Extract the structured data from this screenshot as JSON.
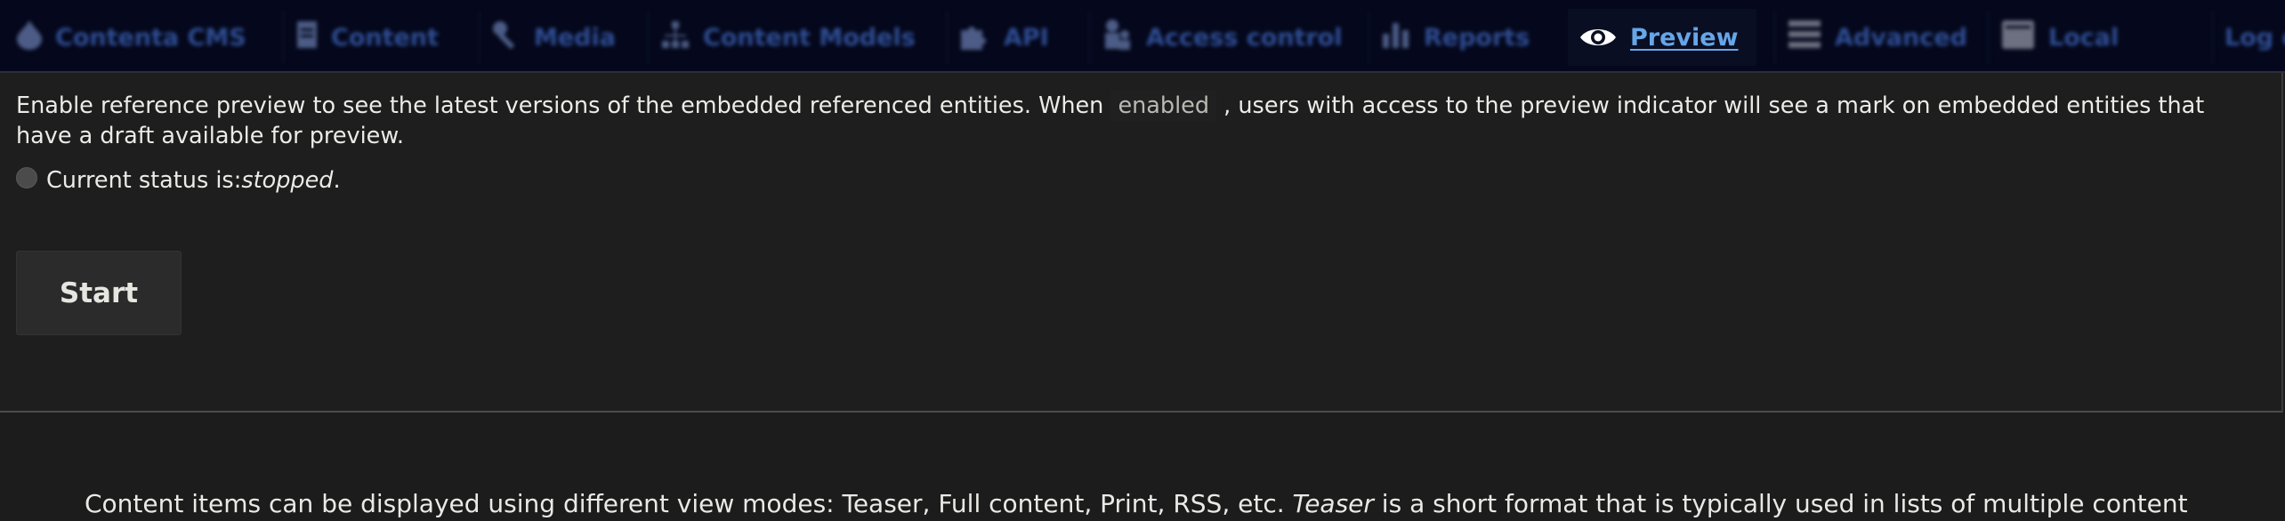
{
  "nav": {
    "items": [
      {
        "label": "Contenta CMS",
        "icon": "drupal-drop-icon"
      },
      {
        "label": "Content",
        "icon": "document-icon"
      },
      {
        "label": "Media",
        "icon": "wrench-icon"
      },
      {
        "label": "Content Models",
        "icon": "hierarchy-icon"
      },
      {
        "label": "API",
        "icon": "puzzle-icon"
      },
      {
        "label": "Access control",
        "icon": "people-icon"
      },
      {
        "label": "Reports",
        "icon": "bar-chart-icon"
      },
      {
        "label": "Advanced",
        "icon": "hamburger-icon"
      },
      {
        "label": "Local",
        "icon": "local-icon"
      },
      {
        "label": "Log o",
        "icon": ""
      }
    ],
    "active": {
      "label": "Preview",
      "icon": "eye-icon"
    }
  },
  "preview": {
    "description_before": "Enable reference preview to see the latest versions of the embedded referenced entities. When ",
    "description_chip": "enabled",
    "description_after": " , users with access to the preview indicator will see a mark on embedded entities that have a draft available for preview.",
    "status_label": "Current status is: ",
    "status_value": "stopped",
    "status_suffix": ".",
    "start_button": "Start"
  },
  "lower": {
    "text_before": "Content items can be displayed using different view modes: Teaser, Full content, Print, RSS, etc. ",
    "text_italic": "Teaser",
    "text_after": " is a short format that is typically used in lists of multiple content"
  },
  "colors": {
    "topbar_bg": "#05081c",
    "nav_text": "#2e4d93",
    "active_link": "#66a6e8",
    "page_bg": "#1b1c1b",
    "button_bg": "#2a2b2a"
  }
}
